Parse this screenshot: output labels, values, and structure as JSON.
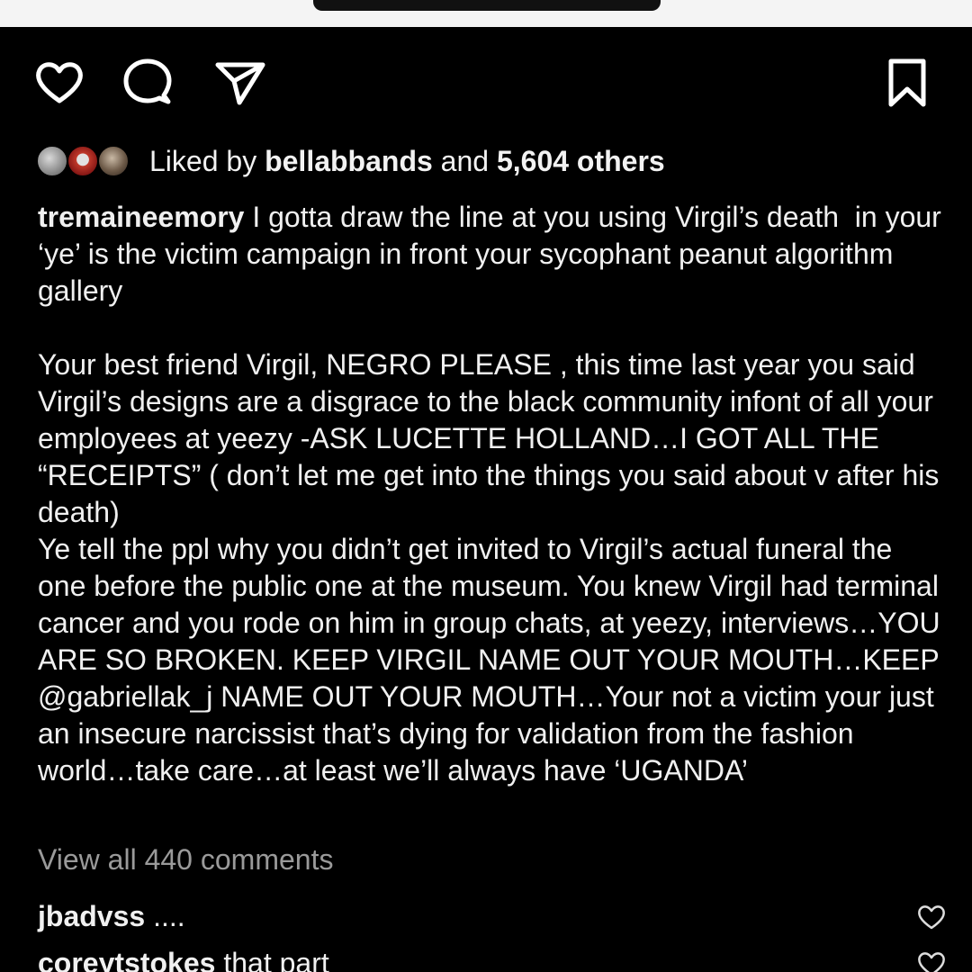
{
  "post": {
    "liked_by_prefix": "Liked by",
    "liked_by_user": "bellabbands",
    "liked_by_and": "and",
    "liked_by_others": "5,604 others",
    "caption_username": "tremaineemory",
    "caption_para1": "I gotta draw the line at you using Virgil’s death  in your ‘ye’ is the victim campaign in front your sycophant peanut algorithm gallery",
    "caption_para2": "Your best friend Virgil, NEGRO PLEASE , this time last year you said Virgil’s designs are a disgrace to the black community infont of all your employees at yeezy -ASK LUCETTE HOLLAND…I GOT ALL THE “RECEIPTS” ( don’t let me get into the things you said about v after his death)",
    "caption_para3": "Ye tell the ppl why you didn’t get invited to Virgil’s actual funeral the one before the public one at the museum. You knew Virgil had terminal cancer and you rode on him in group chats, at yeezy, interviews…YOU ARE SO BROKEN. KEEP VIRGIL NAME OUT YOUR MOUTH…KEEP @gabriellak_j NAME OUT YOUR MOUTH…Your not a victim your just an insecure narcissist that’s dying for validation from the fashion world…take care…at least we’ll always have ‘UGANDA’",
    "view_all_comments": "View all 440 comments"
  },
  "comments": [
    {
      "user": "jbadvss",
      "text": "...."
    },
    {
      "user": "coreytstokes",
      "text": "that part"
    }
  ],
  "icons": {
    "like": "heart-icon",
    "comment": "comment-bubble-icon",
    "share": "paper-plane-icon",
    "save": "bookmark-icon"
  },
  "colors": {
    "background": "#000000",
    "text": "#f0f0f0",
    "muted": "#9a9a9a"
  }
}
